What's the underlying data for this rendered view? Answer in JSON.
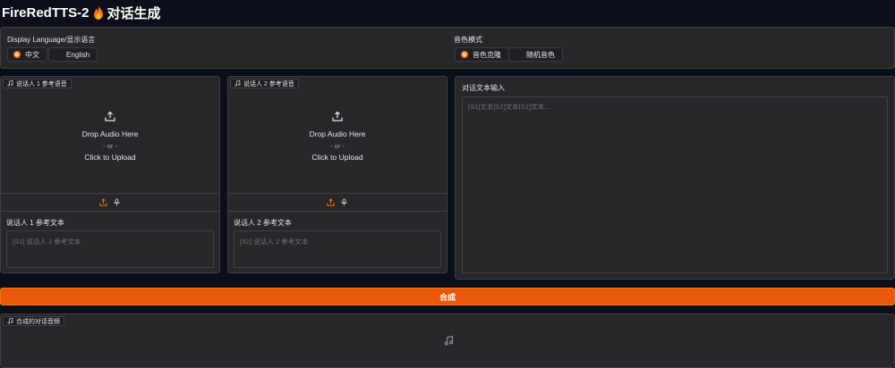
{
  "header": {
    "title": "FireRedTTS-2",
    "subtitle": "对话生成"
  },
  "settings": {
    "language_label": "Display Language/显示语言",
    "language_options": [
      "中文",
      "English"
    ],
    "language_selected": "中文",
    "voice_mode_label": "音色模式",
    "voice_mode_options": [
      "音色克隆",
      "随机音色"
    ],
    "voice_mode_selected": "音色克隆"
  },
  "speaker1": {
    "audio_label": "说话人 1 参考语音",
    "drop_text": "Drop Audio Here",
    "or_text": "- or -",
    "click_text": "Click to Upload",
    "text_label": "说话人 1 参考文本",
    "text_placeholder": "[S1] 说话人 1 参考文本"
  },
  "speaker2": {
    "audio_label": "说话人 2 参考语音",
    "drop_text": "Drop Audio Here",
    "or_text": "- or -",
    "click_text": "Click to Upload",
    "text_label": "说话人 2 参考文本",
    "text_placeholder": "[S2] 说话人 2 参考文本"
  },
  "dialog": {
    "label": "对话文本输入",
    "placeholder": "[S1]文本[S2]文本[S1]文本..."
  },
  "actions": {
    "synthesize_label": "合成"
  },
  "output": {
    "label": "合成的对话音频"
  },
  "colors": {
    "accent": "#ea580c",
    "background": "#0b0f19",
    "panel": "#27272a"
  },
  "icons": {
    "title_icon": "flame-icon",
    "upload": "upload-icon",
    "microphone": "microphone-icon",
    "music": "music-note-icon"
  }
}
